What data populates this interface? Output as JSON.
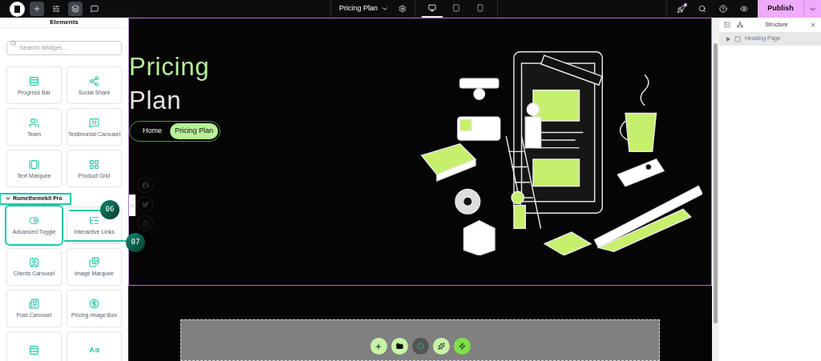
{
  "top_bar": {
    "tools": [
      {
        "kind": "add",
        "selected": true
      },
      {
        "kind": "settings",
        "selected": false
      },
      {
        "kind": "layers",
        "selected": true
      },
      {
        "kind": "comments",
        "selected": false
      }
    ],
    "page_title": "Pricing Plan",
    "devices": [
      {
        "kind": "desktop",
        "selected": true
      },
      {
        "kind": "tablet",
        "selected": false
      },
      {
        "kind": "mobile",
        "selected": false
      }
    ],
    "has_notification": true,
    "publish": "Publish"
  },
  "elements_panel": {
    "title": "Elements",
    "search": {
      "placeholder": "Search Widget..."
    },
    "widgets": [
      {
        "label": "Progress Bar"
      },
      {
        "label": "Social Share"
      },
      {
        "label": "Team"
      },
      {
        "label": "Testimonial Carousel"
      },
      {
        "label": "Text Marquee"
      },
      {
        "label": "Product Grid"
      }
    ],
    "section": {
      "label": "Romethemekit Pro",
      "expanded": true,
      "highlighted": true
    },
    "pro_widgets": [
      {
        "label": "Advanced Toggle",
        "highlighted": true
      },
      {
        "label": "Interactive Links",
        "highlighted": false
      },
      {
        "label": "Clients Carousel",
        "highlighted": false
      },
      {
        "label": "Image Marquee",
        "highlighted": false
      },
      {
        "label": "Post Carousel",
        "highlighted": false
      },
      {
        "label": "Pricing Image Box",
        "highlighted": false
      }
    ]
  },
  "annotations": [
    {
      "label": "06"
    },
    {
      "label": "07"
    }
  ],
  "hero": {
    "title_line_1": "Pricing",
    "title_line_2": "Plan",
    "breadcrumbs": [
      {
        "label": "Home",
        "selected": false
      },
      {
        "label": "Pricing Plan",
        "selected": true
      }
    ],
    "social": [
      {
        "kind": "facebook"
      },
      {
        "kind": "twitter"
      },
      {
        "kind": "instagram"
      }
    ]
  },
  "drop_zone": {
    "actions": [
      {
        "kind": "add"
      },
      {
        "kind": "folder"
      },
      {
        "kind": "logo"
      },
      {
        "kind": "ai"
      },
      {
        "kind": "kit"
      }
    ]
  },
  "structure": {
    "title": "Structure",
    "items": [
      {
        "label": "Heading Page",
        "expanded": false
      }
    ]
  }
}
